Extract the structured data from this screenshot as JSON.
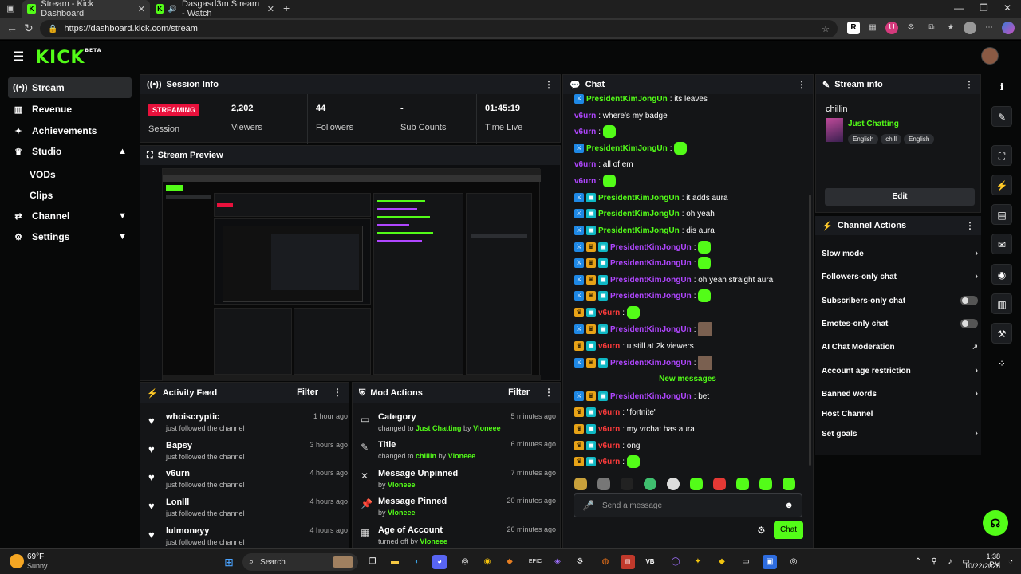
{
  "browser": {
    "tabs": [
      {
        "title": "Stream - Kick Dashboard"
      },
      {
        "title": "Dasgasd3m Stream - Watch"
      }
    ],
    "url": "https://dashboard.kick.com/stream",
    "extensions": [
      "R",
      "U"
    ]
  },
  "app": {
    "logo": "KICK",
    "logo_sup": "BETA"
  },
  "sidebar": {
    "items": [
      {
        "label": "Stream",
        "icon": "broadcast-icon"
      },
      {
        "label": "Revenue",
        "icon": "chart-icon"
      },
      {
        "label": "Achievements",
        "icon": "star-icon"
      },
      {
        "label": "Studio",
        "icon": "trophy-icon"
      },
      {
        "label": "VODs"
      },
      {
        "label": "Clips"
      },
      {
        "label": "Channel",
        "icon": "channel-icon"
      },
      {
        "label": "Settings",
        "icon": "gear-icon"
      }
    ]
  },
  "session": {
    "title": "Session Info",
    "badge": "STREAMING",
    "stats": [
      {
        "value": "",
        "label": "Session"
      },
      {
        "value": "2,202",
        "label": "Viewers"
      },
      {
        "value": "44",
        "label": "Followers"
      },
      {
        "value": "-",
        "label": "Sub Counts"
      },
      {
        "value": "01:45:19",
        "label": "Time Live"
      }
    ]
  },
  "preview": {
    "title": "Stream Preview"
  },
  "activity": {
    "title": "Activity Feed",
    "filter": "Filter",
    "rows": [
      {
        "name": "whoiscryptic",
        "desc": "just followed the channel",
        "time": "1 hour ago"
      },
      {
        "name": "Bapsy",
        "desc": "just followed the channel",
        "time": "3 hours ago"
      },
      {
        "name": "v6urn",
        "desc": "just followed the channel",
        "time": "4 hours ago"
      },
      {
        "name": "Lonlll",
        "desc": "just followed the channel",
        "time": "4 hours ago"
      },
      {
        "name": "lulmoneyy",
        "desc": "just followed the channel",
        "time": "4 hours ago"
      }
    ]
  },
  "mod": {
    "title": "Mod Actions",
    "filter": "Filter",
    "rows": [
      {
        "name": "Category",
        "pre": "changed to ",
        "hl1": "Just Chatting",
        "mid": " by ",
        "hl2": "Vloneee",
        "time": "5 minutes ago"
      },
      {
        "name": "Title",
        "pre": "changed to ",
        "hl1": "chillin",
        "mid": " by ",
        "hl2": "Vloneee",
        "time": "6 minutes ago"
      },
      {
        "name": "Message Unpinned",
        "pre": "by ",
        "hl1": "",
        "mid": "",
        "hl2": "Vloneee",
        "time": "7 minutes ago"
      },
      {
        "name": "Message Pinned",
        "pre": "by ",
        "hl1": "",
        "mid": "",
        "hl2": "Vloneee",
        "time": "20 minutes ago"
      },
      {
        "name": "Age of Account",
        "pre": "turned off by ",
        "hl1": "",
        "mid": "",
        "hl2": "Vloneee",
        "time": "26 minutes ago"
      }
    ]
  },
  "chat": {
    "title": "Chat",
    "new_messages": "New messages",
    "placeholder": "Send a message",
    "send": "Chat",
    "lines": [
      {
        "user": "PresidentKimJongUn",
        "text": ": its leaves"
      },
      {
        "user": "v6urn",
        "text": ": where's my badge"
      },
      {
        "user": "v6urn",
        "text": ":"
      },
      {
        "user": "PresidentKimJongUn",
        "text": ":"
      },
      {
        "user": "v6urn",
        "text": ": all of em"
      },
      {
        "user": "v6urn",
        "text": ":"
      },
      {
        "user": "PresidentKimJongUn",
        "text": ": it adds aura"
      },
      {
        "user": "PresidentKimJongUn",
        "text": ": oh yeah"
      },
      {
        "user": "PresidentKimJongUn",
        "text": ": dis aura"
      },
      {
        "user": "PresidentKimJongUn",
        "text": ":"
      },
      {
        "user": "PresidentKimJongUn",
        "text": ":"
      },
      {
        "user": "PresidentKimJongUn",
        "text": ": oh yeah straight aura"
      },
      {
        "user": "PresidentKimJongUn",
        "text": ":"
      },
      {
        "user": "v6urn",
        "text": ":"
      },
      {
        "user": "PresidentKimJongUn",
        "text": ":"
      },
      {
        "user": "v6urn",
        "text": ": u still at 2k viewers"
      },
      {
        "user": "PresidentKimJongUn",
        "text": ":"
      },
      {
        "user": "PresidentKimJongUn",
        "text": ": bet"
      },
      {
        "user": "v6urn",
        "text": ": \"fortnite\""
      },
      {
        "user": "v6urn",
        "text": ": my vrchat has aura"
      },
      {
        "user": "v6urn",
        "text": ": ong"
      },
      {
        "user": "v6urn",
        "text": ":"
      }
    ]
  },
  "stream_info": {
    "title": "Stream info",
    "stream_title": "chillin",
    "category": "Just Chatting",
    "tags": [
      "English",
      "chill",
      "English"
    ],
    "edit": "Edit"
  },
  "channel_actions": {
    "title": "Channel Actions",
    "items": [
      {
        "label": "Slow mode",
        "ctrl": "chevron"
      },
      {
        "label": "Followers-only chat",
        "ctrl": "chevron"
      },
      {
        "label": "Subscribers-only chat",
        "ctrl": "toggle"
      },
      {
        "label": "Emotes-only chat",
        "ctrl": "toggle"
      },
      {
        "label": "AI Chat Moderation",
        "ctrl": "external"
      },
      {
        "label": "Account age restriction",
        "ctrl": "chevron"
      },
      {
        "label": "Banned words",
        "ctrl": "chevron"
      },
      {
        "label": "Host Channel",
        "ctrl": "none"
      },
      {
        "label": "Set goals",
        "ctrl": "chevron"
      }
    ]
  },
  "taskbar": {
    "weather_temp": "69°F",
    "weather_desc": "Sunny",
    "search": "Search",
    "time": "1:38 PM",
    "date": "10/22/2025"
  },
  "colors": {
    "accent": "#53fc18",
    "live": "#e9113c",
    "panel": "#141517"
  }
}
